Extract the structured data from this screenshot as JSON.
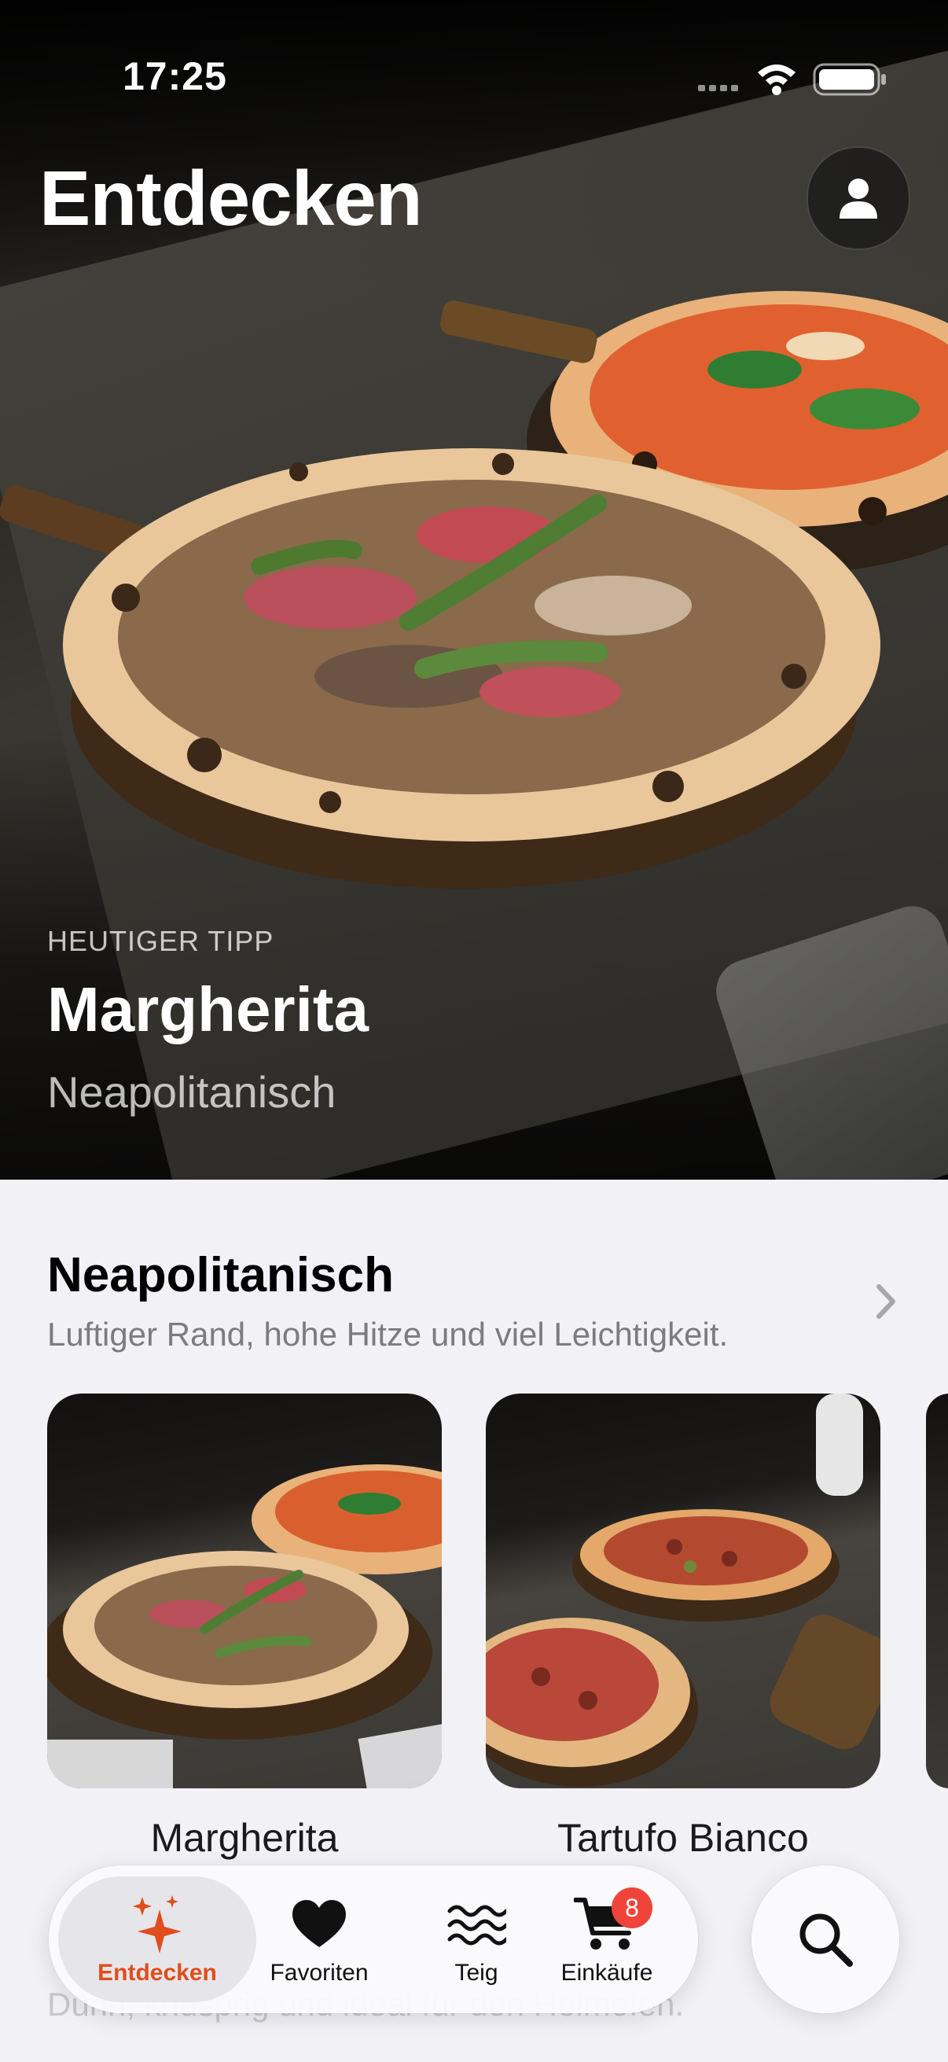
{
  "status_bar": {
    "time": "17:25"
  },
  "header": {
    "title": "Entdecken"
  },
  "hero": {
    "eyebrow": "HEUTIGER TIPP",
    "title": "Margherita",
    "subtitle": "Neapolitanisch"
  },
  "section": {
    "title": "Neapolitanisch",
    "description": "Luftiger Rand, hohe Hitze und viel Leichtigkeit.",
    "cards": [
      {
        "label": "Margherita"
      },
      {
        "label": "Tartufo Bianco"
      }
    ]
  },
  "next_section": {
    "description": "Dünn, knusprig und ideal für den Heimofen."
  },
  "tab_bar": {
    "tabs": [
      {
        "label": "Entdecken",
        "icon": "sparkles-icon",
        "active": true
      },
      {
        "label": "Favoriten",
        "icon": "heart-icon",
        "active": false
      },
      {
        "label": "Teig",
        "icon": "waves-icon",
        "active": false
      },
      {
        "label": "Einkäufe",
        "icon": "cart-icon",
        "active": false,
        "badge": "8"
      }
    ]
  },
  "colors": {
    "accent": "#e14d1c",
    "badge": "#f0443a",
    "background": "#f2f1f6"
  }
}
